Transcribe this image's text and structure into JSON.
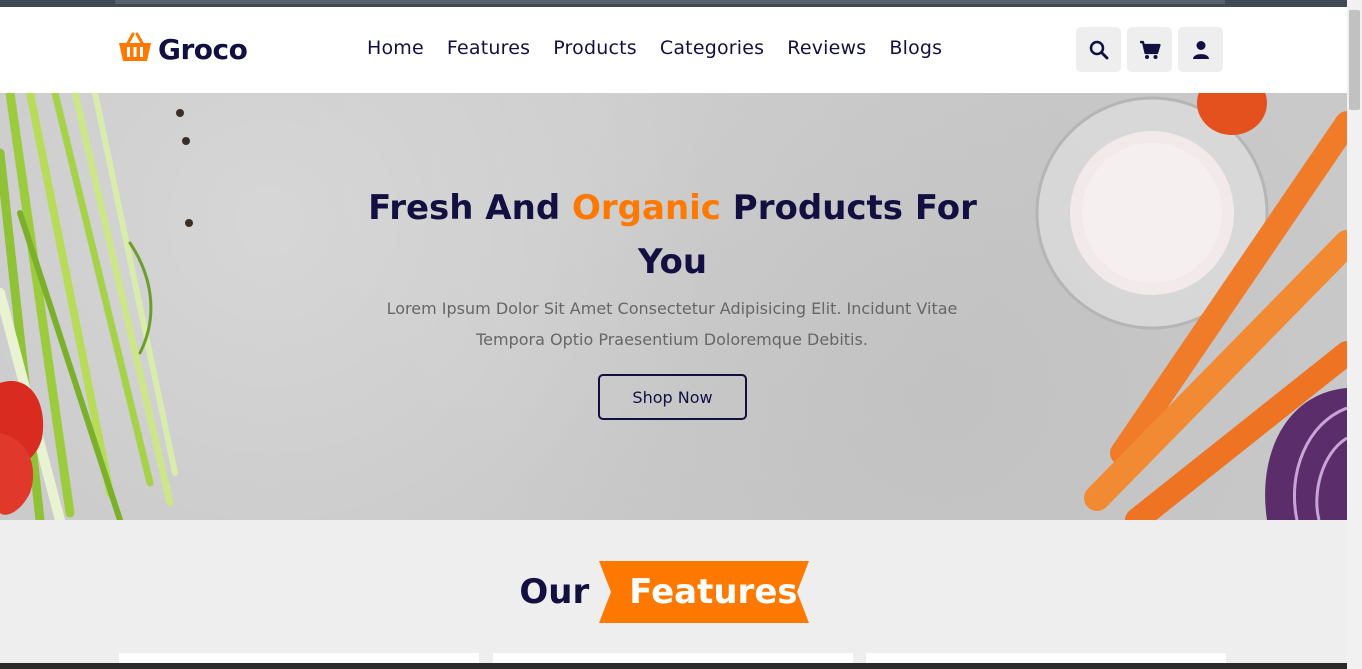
{
  "brand": {
    "name": "Groco",
    "icon": "basket-icon",
    "accent": "#ff7800",
    "dark": "#130f40"
  },
  "nav": [
    {
      "label": "Home"
    },
    {
      "label": "Features"
    },
    {
      "label": "Products"
    },
    {
      "label": "Categories"
    },
    {
      "label": "Reviews"
    },
    {
      "label": "Blogs"
    }
  ],
  "header_icons": [
    "search-icon",
    "cart-icon",
    "user-icon"
  ],
  "hero": {
    "title_before": "Fresh And ",
    "title_accent": "Organic",
    "title_after": " Products For You",
    "subtitle": "Lorem Ipsum Dolor Sit Amet Consectetur Adipisicing Elit. Incidunt Vitae Tempora Optio Praesentium Doloremque Debitis.",
    "button": "Shop Now"
  },
  "features": {
    "heading_plain": "Our",
    "heading_ribbon": "Features"
  }
}
